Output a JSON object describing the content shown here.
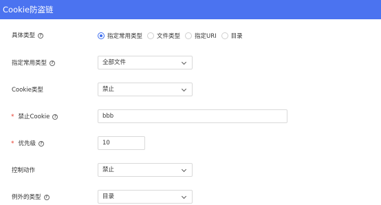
{
  "header": {
    "title": "Cookie防盗链"
  },
  "form": {
    "content_type": {
      "label": "具体类型",
      "options": [
        "指定常用类型",
        "文件类型",
        "指定URI",
        "目录"
      ],
      "selected": "指定常用类型"
    },
    "common_type": {
      "label": "指定常用类型",
      "value": "全部文件"
    },
    "cookie_type": {
      "label": "Cookie类型",
      "value": "禁止"
    },
    "forbid_cookie": {
      "required_mark": "*",
      "label": "禁止Cookie",
      "value": "bbb"
    },
    "priority": {
      "required_mark": "*",
      "label": "优先级",
      "value": "10"
    },
    "control_action": {
      "label": "控制动作",
      "value": "禁止"
    },
    "exception_type": {
      "label": "例外的类型",
      "value": "目录"
    }
  },
  "icons": {
    "help": "question-circle-icon",
    "dropdown": "chevron-down-icon"
  },
  "colors": {
    "header_bg": "#4b73f0",
    "accent": "#3c6df0",
    "required": "#e63d2e"
  }
}
